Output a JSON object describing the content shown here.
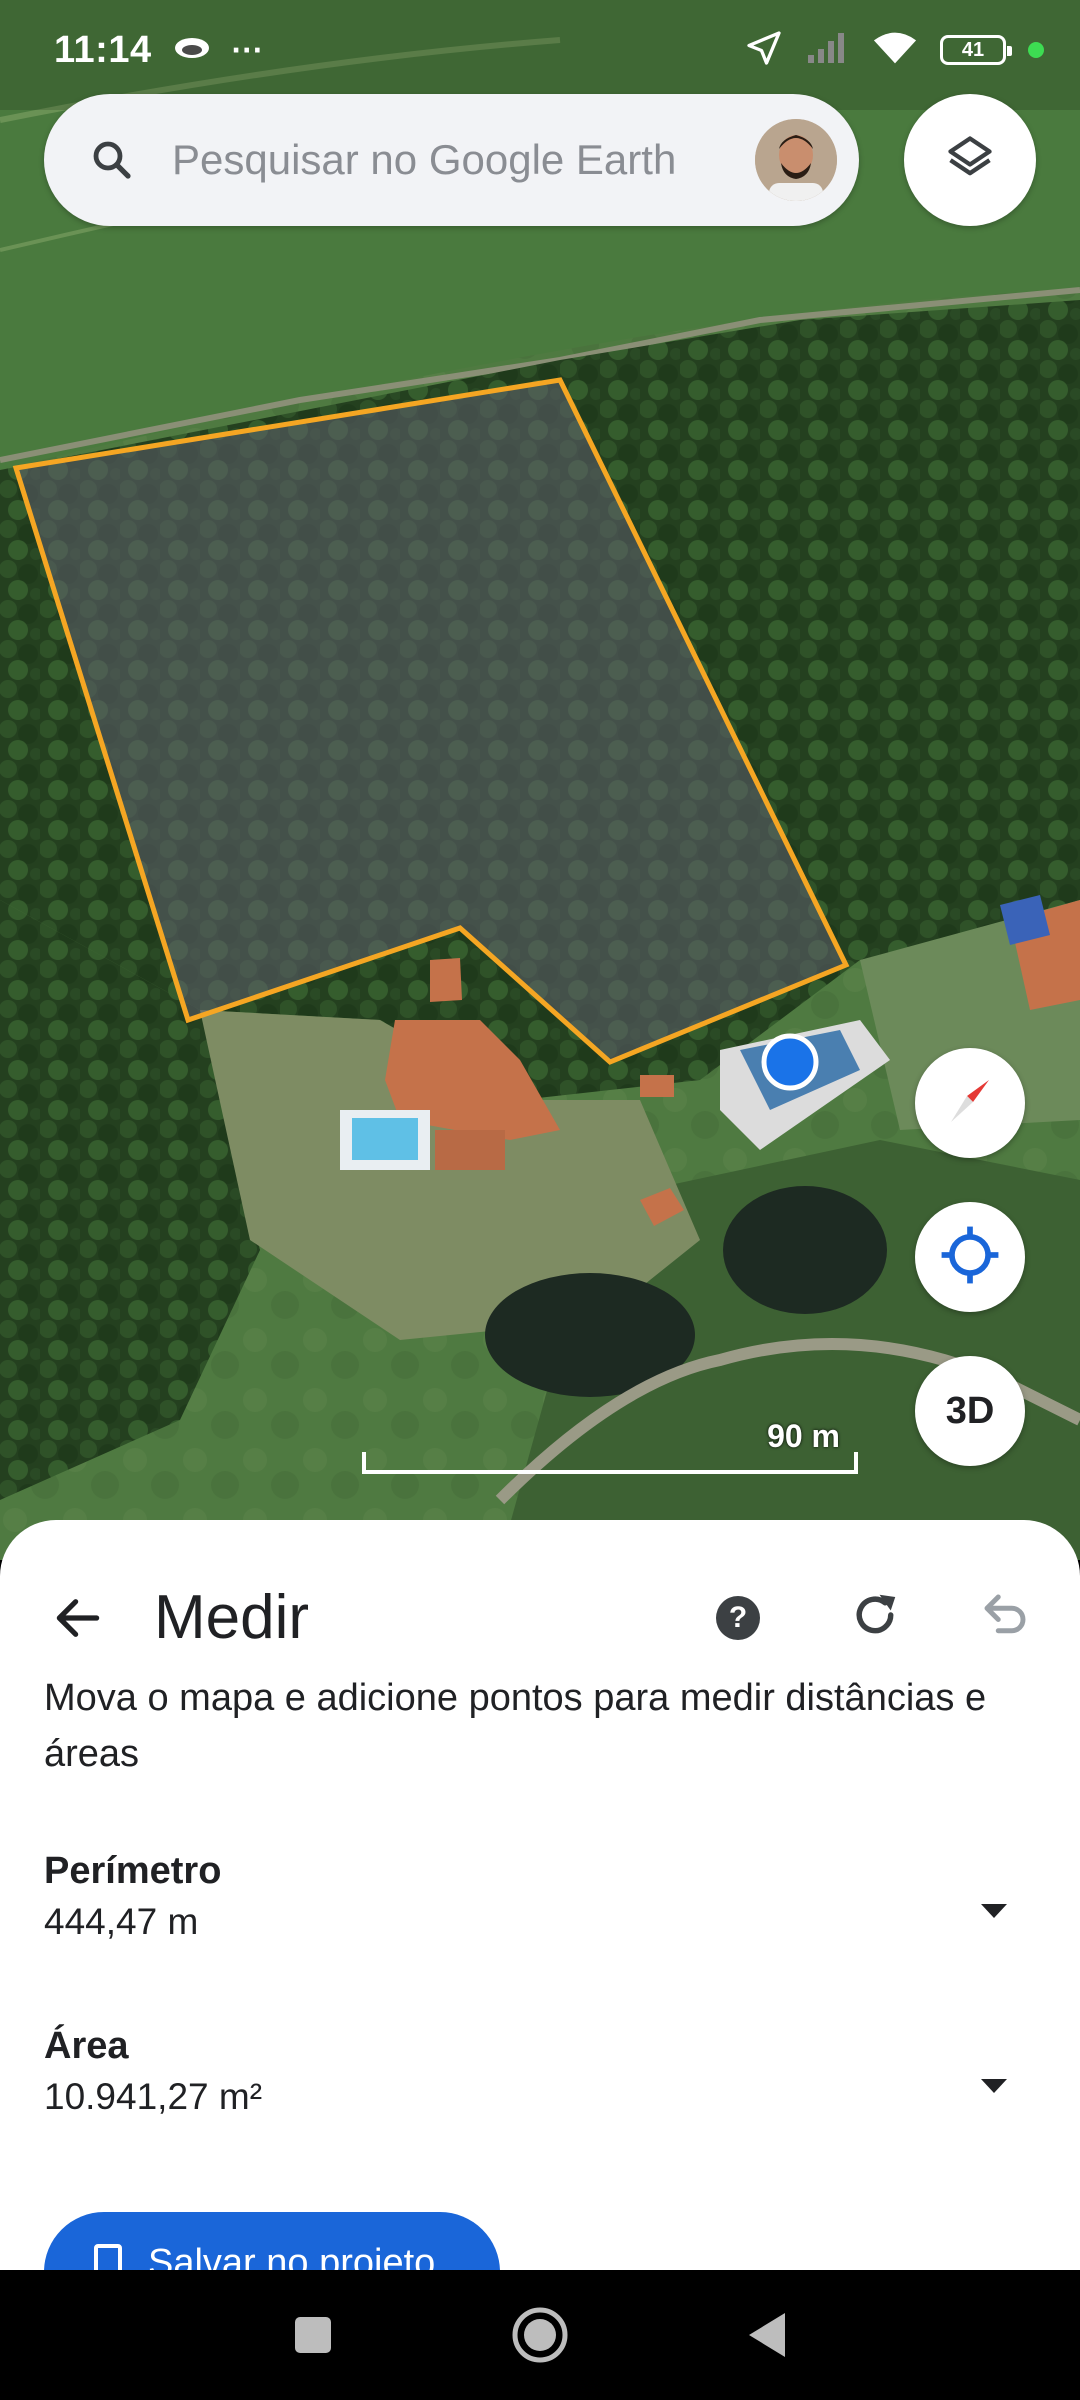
{
  "status_bar": {
    "time": "11:14",
    "more": "···",
    "battery": "41"
  },
  "search": {
    "placeholder": "Pesquisar no Google Earth"
  },
  "map": {
    "scale_label": "90 m",
    "three_d_label": "3D"
  },
  "measure_panel": {
    "title": "Medir",
    "help_label": "?",
    "instructions": "Mova o mapa e adicione pontos para medir distâncias e áreas",
    "perimeter": {
      "label": "Perímetro",
      "value": "444,47 m"
    },
    "area": {
      "label": "Área",
      "value": "10.941,27 m²"
    },
    "save_label": "Salvar no projeto"
  },
  "colors": {
    "polygon_outline": "#f5a623",
    "accent_blue": "#1a66d9",
    "location_dot": "#1a73e8"
  },
  "icons": [
    "status-eye-icon",
    "location-arrow-icon",
    "signal-icon",
    "wifi-icon",
    "battery-icon",
    "search-icon",
    "avatar",
    "layers-icon",
    "compass-icon",
    "my-location-icon",
    "back-arrow-icon",
    "help-icon",
    "reset-icon",
    "undo-icon",
    "chevron-down-icon",
    "bookmark-icon",
    "nav-recents-icon",
    "nav-home-icon",
    "nav-back-icon"
  ]
}
